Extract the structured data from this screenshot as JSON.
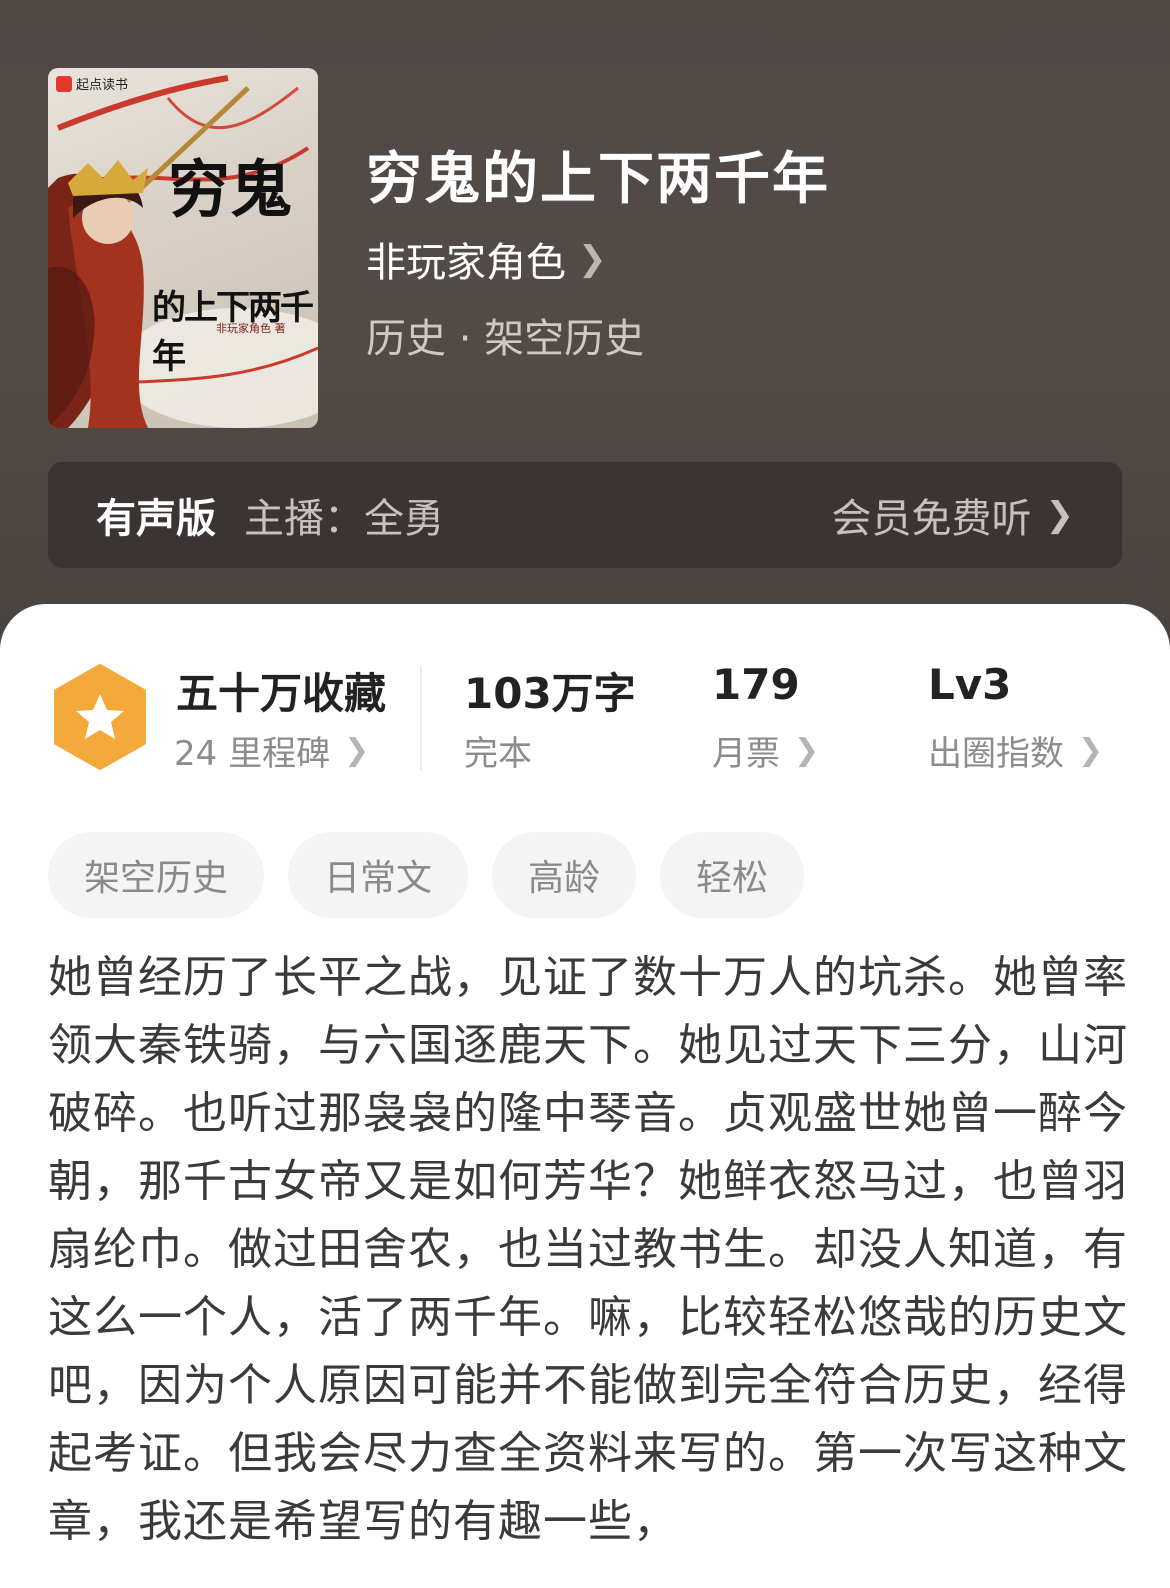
{
  "book": {
    "title": "穷鬼的上下两千年",
    "author": "非玩家角色",
    "genre": "历史 · 架空历史",
    "cover": {
      "brand": "起点读书",
      "title_big": "穷鬼",
      "title_small": "的上下两千年",
      "author_line": "非玩家角色 著"
    }
  },
  "audio": {
    "label": "有声版",
    "anchor": "主播：全勇",
    "action": "会员免费听"
  },
  "stats": {
    "favorites": "五十万收藏",
    "milestones": "24 里程碑",
    "words": "103万字",
    "status": "完本",
    "monthly_votes": "179",
    "monthly_label": "月票",
    "level": "Lv3",
    "level_label": "出圈指数"
  },
  "tags": [
    "架空历史",
    "日常文",
    "高龄",
    "轻松"
  ],
  "description": "她曾经历了长平之战，见证了数十万人的坑杀。她曾率领大秦铁骑，与六国逐鹿天下。她见过天下三分，山河破碎。也听过那袅袅的隆中琴音。贞观盛世她曾一醉今朝，那千古女帝又是如何芳华？她鲜衣怒马过，也曾羽扇纶巾。做过田舍农，也当过教书生。却没人知道，有这么一个人，活了两千年。嘛，比较轻松悠哉的历史文吧，因为个人原因可能并不能做到完全符合历史，经得起考证。但我会尽力查全资料来写的。第一次写这种文章，我还是希望写的有趣一些，",
  "colors": {
    "header_bg": "#4f4845",
    "badge_orange": "#f4a93b",
    "tag_bg": "#f4f4f4"
  }
}
